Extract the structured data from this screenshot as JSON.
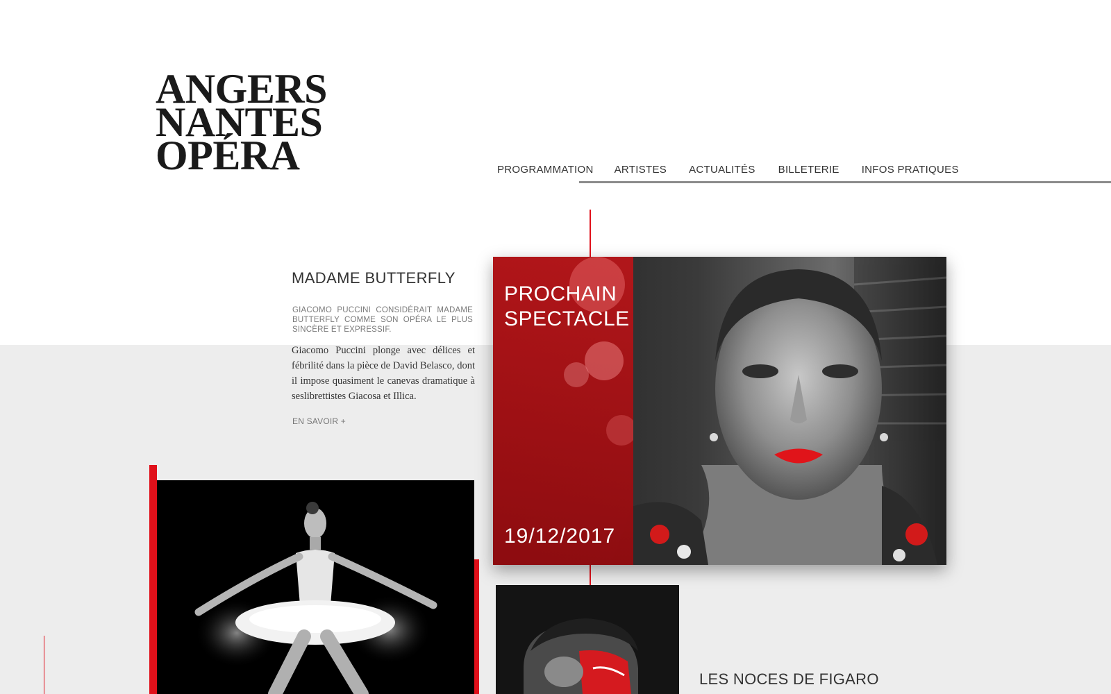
{
  "logo": {
    "line1": "ANGERS",
    "line2": "NANTES",
    "line3": "OPÉRA"
  },
  "nav": {
    "items": [
      {
        "label": "PROGRAMMATION"
      },
      {
        "label": "ARTISTES"
      },
      {
        "label": "ACTUALITÉS"
      },
      {
        "label": "BILLETERIE"
      },
      {
        "label": "INFOS PRATIQUES"
      }
    ]
  },
  "featured": {
    "title": "MADAME BUTTERFLY",
    "lead": "GIACOMO PUCCINI CONSIDÉRAIT MADAME BUTTERFLY COMME SON OPÉRA LE PLUS SINCÈRE ET EXPRESSIF.",
    "body": "Giacomo Puccini plonge avec délices et fébrilité dans la pièce de David Belasco, dont il impose quasiment le canevas dramatique à seslibrettistes Giacosa et Illica.",
    "link": "EN SAVOIR +"
  },
  "hero": {
    "title_line1": "PROCHAIN",
    "title_line2": "SPECTACLE",
    "date": "19/12/2017"
  },
  "next": {
    "title": "LES NOCES DE FIGARO"
  },
  "colors": {
    "accent": "#e0101a",
    "overlay_red": "#b81418",
    "band_grey": "#ededed"
  }
}
